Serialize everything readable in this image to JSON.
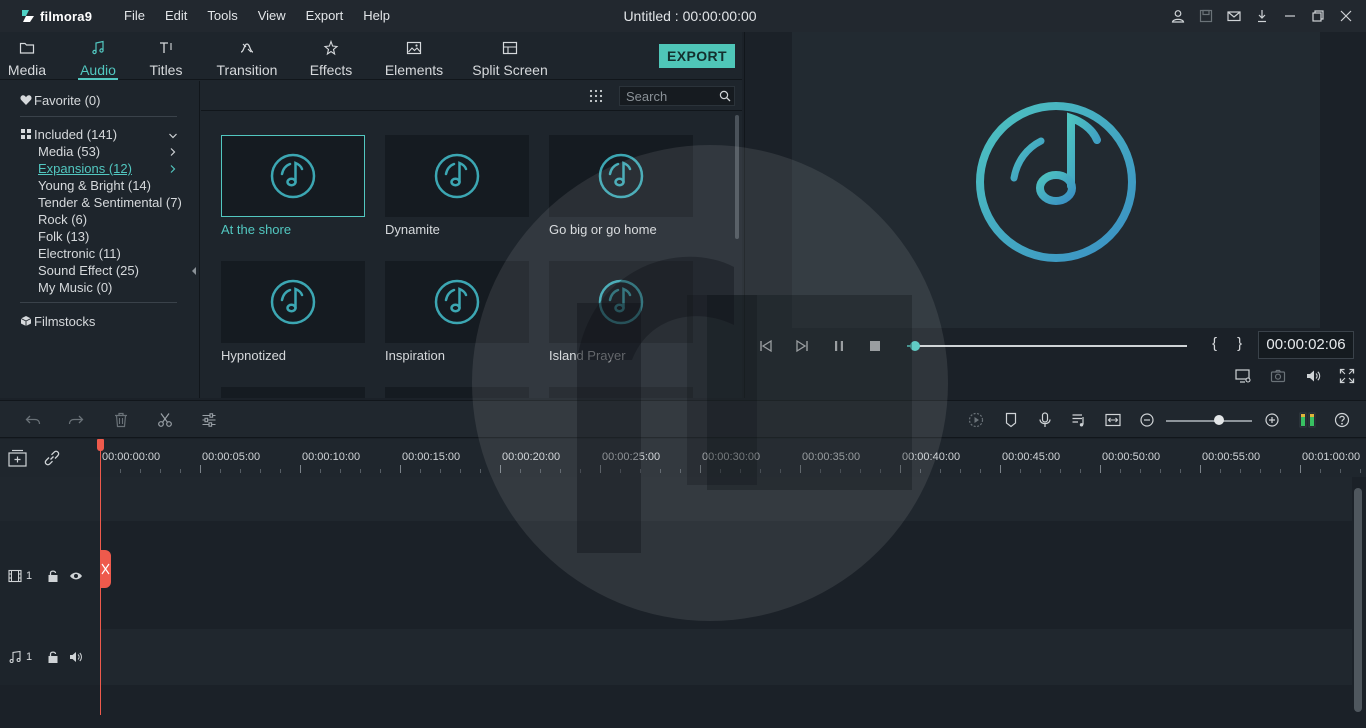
{
  "app": {
    "logo_text": "filmora9",
    "title": "Untitled : 00:00:00:00",
    "menu": [
      "File",
      "Edit",
      "Tools",
      "View",
      "Export",
      "Help"
    ]
  },
  "library": {
    "tabs": [
      {
        "label": "Media",
        "icon": "folder-icon"
      },
      {
        "label": "Audio",
        "icon": "music-note-icon",
        "active": true
      },
      {
        "label": "Titles",
        "icon": "text-icon"
      },
      {
        "label": "Transition",
        "icon": "transition-icon"
      },
      {
        "label": "Effects",
        "icon": "effects-icon"
      },
      {
        "label": "Elements",
        "icon": "image-icon"
      },
      {
        "label": "Split Screen",
        "icon": "split-screen-icon"
      }
    ],
    "export_label": "EXPORT",
    "sidebar": {
      "favorite": "Favorite (0)",
      "included": "Included (141)",
      "categories": [
        "Media (53)",
        "Expansions (12)",
        "Young & Bright (14)",
        "Tender & Sentimental (7)",
        "Rock (6)",
        "Folk (13)",
        "Electronic (11)",
        "Sound Effect (25)",
        "My Music (0)"
      ],
      "selected_category": "Expansions (12)",
      "filmstocks": "Filmstocks"
    },
    "search": {
      "placeholder": "Search",
      "value": ""
    },
    "items": [
      {
        "label": "At the shore",
        "selected": true
      },
      {
        "label": "Dynamite"
      },
      {
        "label": "Go big or go home"
      },
      {
        "label": "Hypnotized"
      },
      {
        "label": "Inspiration"
      },
      {
        "label": "Island Prayer"
      }
    ]
  },
  "preview": {
    "timecode": "00:00:02:06",
    "braces": "{ }",
    "progress": 0.03
  },
  "timeline": {
    "ruler_labels": [
      "00:00:00:00",
      "00:00:05:00",
      "00:00:10:00",
      "00:00:15:00",
      "00:00:20:00",
      "00:00:25:00",
      "00:00:30:00",
      "00:00:35:00",
      "00:00:40:00",
      "00:00:45:00",
      "00:00:50:00",
      "00:00:55:00",
      "00:01:00:00"
    ],
    "video_track_label": "1",
    "audio_track_label": "1",
    "zoom_level": 0.56
  },
  "colors": {
    "accent": "#52c7c0",
    "export": "#4fc6b8",
    "playhead": "#ee5a4c",
    "background": "#1b2128"
  }
}
